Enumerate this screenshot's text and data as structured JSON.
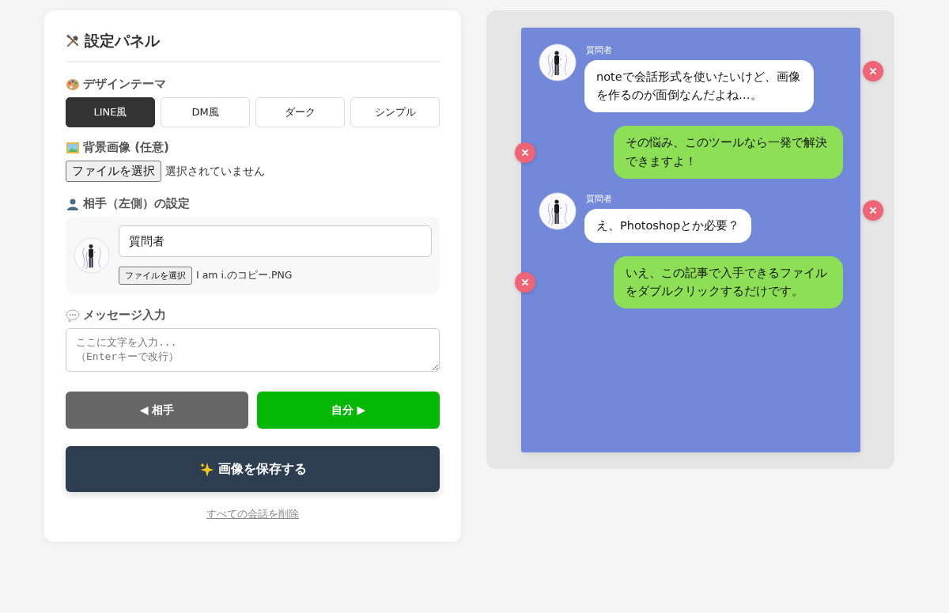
{
  "panel": {
    "title": "設定パネル"
  },
  "theme": {
    "label": "デザインテーマ",
    "options": [
      {
        "label": "LINE風",
        "selected": true
      },
      {
        "label": "DM風",
        "selected": false
      },
      {
        "label": "ダーク",
        "selected": false
      },
      {
        "label": "シンプル",
        "selected": false
      }
    ]
  },
  "background": {
    "label": "背景画像 (任意)",
    "file_button": "ファイルを選択",
    "file_name": "選択されていません"
  },
  "partner": {
    "label": "相手（左側）の設定",
    "name_value": "質問者",
    "file_button": "ファイルを選択",
    "file_name": "I am i.のコピー.PNG"
  },
  "message": {
    "label": "メッセージ入力",
    "placeholder": "ここに文字を入力...\n（Enterキーで改行）"
  },
  "send_buttons": [
    {
      "label": "◀ 相手",
      "kind": "partner"
    },
    {
      "label": "自分 ▶",
      "kind": "self"
    }
  ],
  "save_button": "画像を保存する",
  "clear_link": "すべての会話を削除",
  "chat": {
    "messages": [
      {
        "kind": "partner",
        "name": "質問者",
        "text": "noteで会話形式を使いたいけど、画像を作るのが面倒なんだよね…。"
      },
      {
        "kind": "self",
        "text": "その悩み、このツールなら一発で解決できますよ！"
      },
      {
        "kind": "partner",
        "name": "質問者",
        "text": "え、Photoshopとか必要？"
      },
      {
        "kind": "self",
        "text": "いえ、この記事で入手できるファイルをダブルクリックするだけです。"
      }
    ]
  }
}
